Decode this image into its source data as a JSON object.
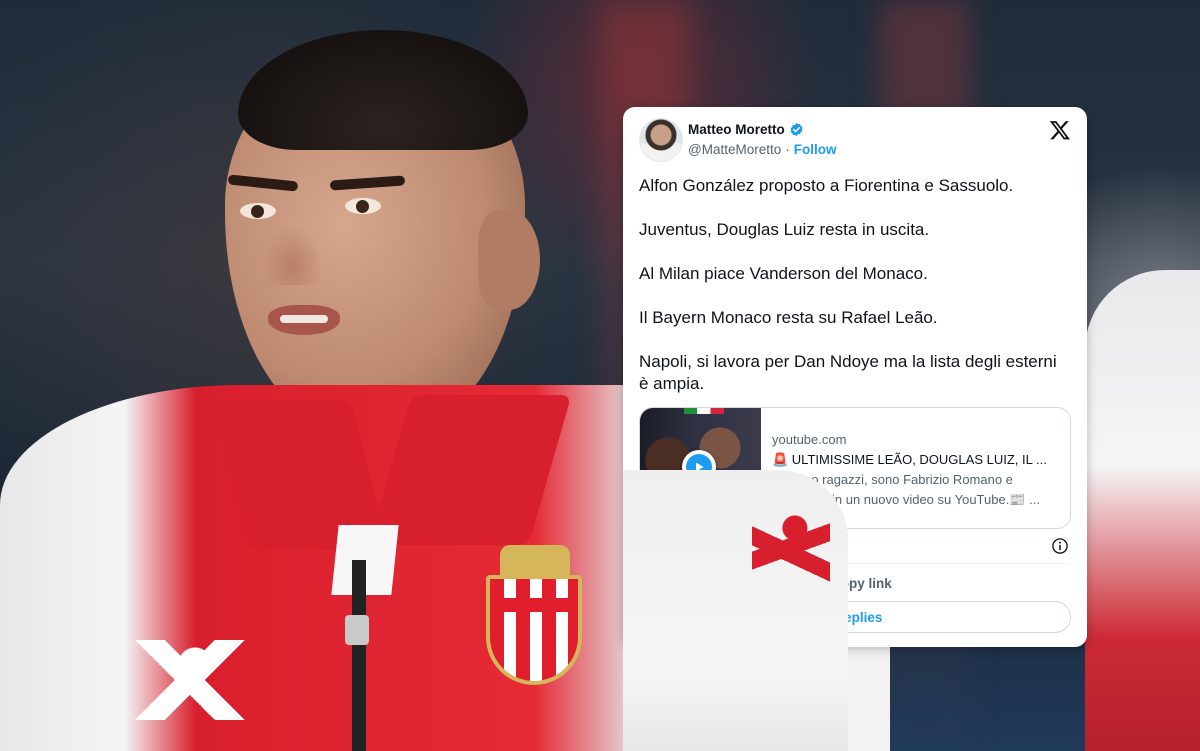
{
  "tweet": {
    "author_name": "Matteo Moretto",
    "handle": "@MatteMoretto",
    "separator": "·",
    "follow_label": "Follow",
    "paragraphs": [
      "Alfon González proposto a Fiorentina e Sassuolo.",
      "Juventus, Douglas Luiz resta in uscita.",
      "Al Milan piace Vanderson del Monaco.",
      "Il Bayern Monaco resta su Rafael Leão.",
      "Napoli, si lavora per Dan Ndoye ma la lista degli esterni è ampia."
    ],
    "link_card": {
      "domain": "youtube.com",
      "title": "🚨 ULTIMISSIME LEÃO, DOUGLAS LUIZ, IL ...",
      "description": "👋 Ciao ragazzi, sono Fabrizio Romano e benvenuti in un nuovo video su YouTube.📰 ..."
    },
    "copy_link_label": "Copy link",
    "replies_label": "8 replies"
  },
  "colors": {
    "accent": "#1d9bf0",
    "text_primary": "#0f1419",
    "text_secondary": "#536471",
    "monaco_red": "#d81f2d"
  },
  "icons": [
    "verified-badge-icon",
    "x-logo-icon",
    "play-icon",
    "info-icon"
  ]
}
